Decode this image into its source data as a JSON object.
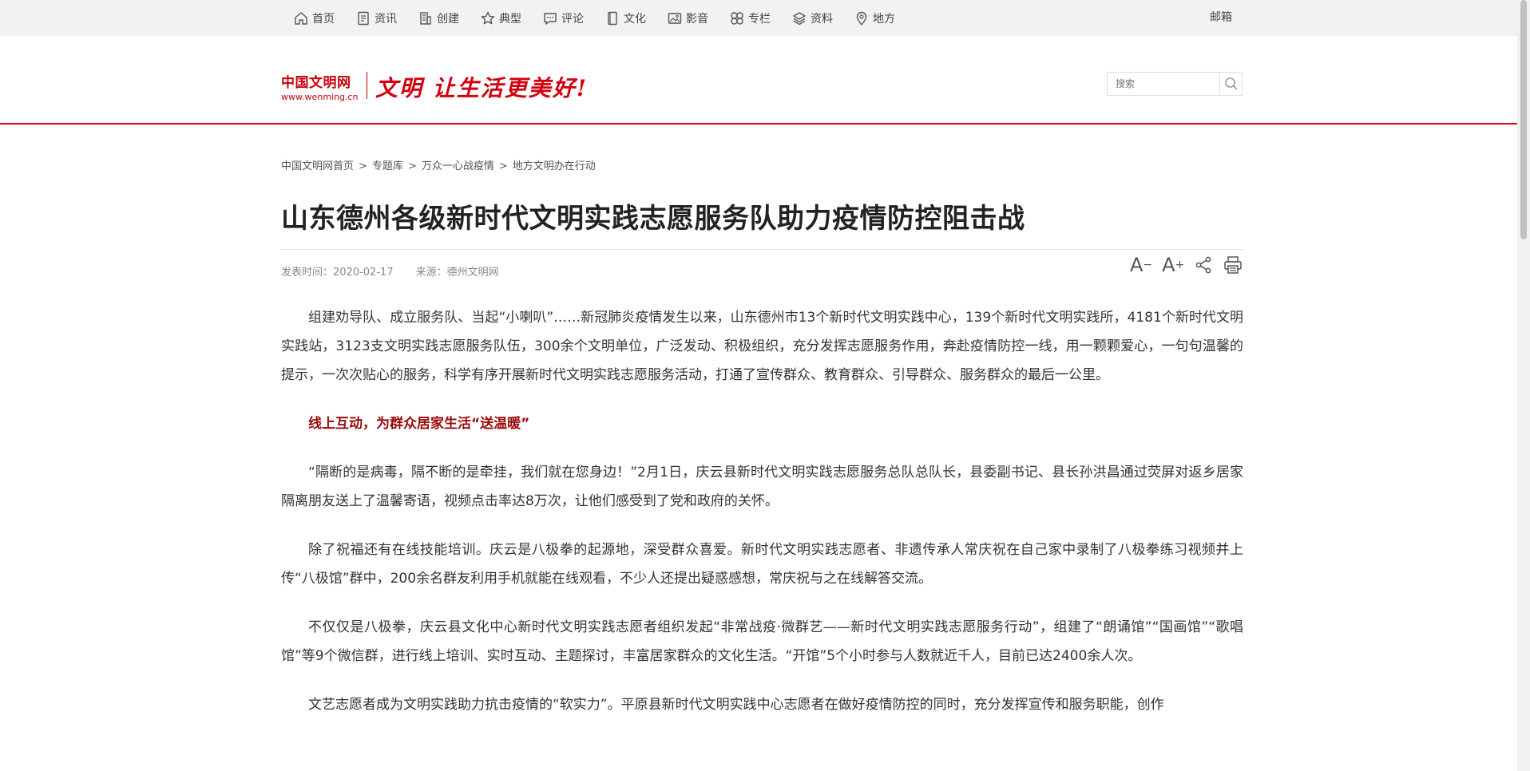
{
  "nav": {
    "items": [
      {
        "label": "首页",
        "icon": "home-icon"
      },
      {
        "label": "资讯",
        "icon": "news-icon"
      },
      {
        "label": "创建",
        "icon": "building-icon"
      },
      {
        "label": "典型",
        "icon": "star-icon"
      },
      {
        "label": "评论",
        "icon": "comment-icon"
      },
      {
        "label": "文化",
        "icon": "book-icon"
      },
      {
        "label": "影音",
        "icon": "image-icon"
      },
      {
        "label": "专栏",
        "icon": "clover-icon"
      },
      {
        "label": "资料",
        "icon": "layers-icon"
      },
      {
        "label": "地方",
        "icon": "location-pin-icon"
      }
    ],
    "mail": "邮箱"
  },
  "header": {
    "logo_cn": "中国文明网",
    "logo_en": "www.wenming.cn",
    "slogan": "文明 让生活更美好!",
    "search_placeholder": "搜索"
  },
  "breadcrumb": [
    "中国文明网首页",
    "专题库",
    "万众一心战疫情",
    "地方文明办在行动"
  ],
  "article": {
    "title": "山东德州各级新时代文明实践志愿服务队助力疫情防控阻击战",
    "publish_time": "发表时间：2020-02-17",
    "source": "来源：德州文明网",
    "tools": {
      "font_smaller": "A",
      "font_larger": "A",
      "minus": "−",
      "plus": "+"
    },
    "paragraphs": [
      "组建劝导队、成立服务队、当起“小喇叭”……新冠肺炎疫情发生以来，山东德州市13个新时代文明实践中心，139个新时代文明实践所，4181个新时代文明实践站，3123支文明实践志愿服务队伍，300余个文明单位，广泛发动、积极组织，充分发挥志愿服务作用，奔赴疫情防控一线，用一颗颗爱心，一句句温馨的提示，一次次贴心的服务，科学有序开展新时代文明实践志愿服务活动，打通了宣传群众、教育群众、引导群众、服务群众的最后一公里。",
      "“隔断的是病毒，隔不断的是牵挂，我们就在您身边！”2月1日，庆云县新时代文明实践志愿服务总队总队长，县委副书记、县长孙洪昌通过荧屏对返乡居家隔离朋友送上了温馨寄语，视频点击率达8万次，让他们感受到了党和政府的关怀。",
      "除了祝福还有在线技能培训。庆云是八极拳的起源地，深受群众喜爱。新时代文明实践志愿者、非遗传承人常庆祝在自己家中录制了八极拳练习视频并上传“八极馆”群中，200余名群友利用手机就能在线观看，不少人还提出疑惑感想，常庆祝与之在线解答交流。",
      "不仅仅是八极拳，庆云县文化中心新时代文明实践志愿者组织发起“非常战疫·微群艺——新时代文明实践志愿服务行动”，组建了“朗诵馆”“国画馆”“歌唱馆”等9个微信群，进行线上培训、实时互动、主题探讨，丰富居家群众的文化生活。“开馆”5个小时参与人数就近千人，目前已达2400余人次。",
      "文艺志愿者成为文明实践助力抗击疫情的“软实力”。平原县新时代文明实践中心志愿者在做好疫情防控的同时，充分发挥宣传和服务职能，创作"
    ],
    "subheading": "线上互动，为群众居家生活“送温暖”"
  }
}
